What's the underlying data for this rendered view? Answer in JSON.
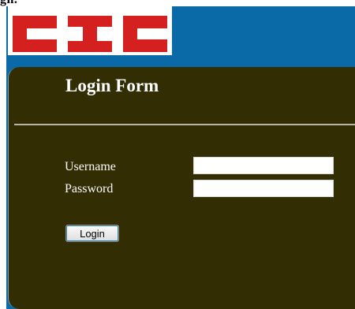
{
  "page": {
    "top_cut_text": "gn."
  },
  "logo": {
    "text": "CIC",
    "color": "#d4211f"
  },
  "form": {
    "title": "Login Form",
    "username_label": "Username",
    "username_value": "",
    "password_label": "Password",
    "password_value": "",
    "login_label": "Login"
  },
  "colors": {
    "header_background": "#0a6aa8",
    "panel_background": "#322d03",
    "divider": "#b5b5a5"
  }
}
